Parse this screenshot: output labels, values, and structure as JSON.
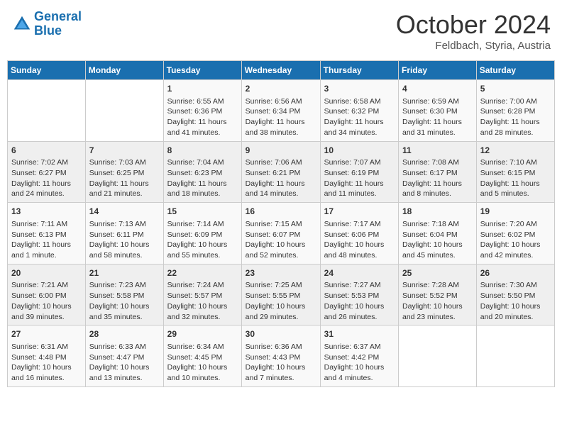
{
  "header": {
    "logo_line1": "General",
    "logo_line2": "Blue",
    "month": "October 2024",
    "location": "Feldbach, Styria, Austria"
  },
  "days_of_week": [
    "Sunday",
    "Monday",
    "Tuesday",
    "Wednesday",
    "Thursday",
    "Friday",
    "Saturday"
  ],
  "weeks": [
    [
      {
        "day": "",
        "info": ""
      },
      {
        "day": "",
        "info": ""
      },
      {
        "day": "1",
        "info": "Sunrise: 6:55 AM\nSunset: 6:36 PM\nDaylight: 11 hours and 41 minutes."
      },
      {
        "day": "2",
        "info": "Sunrise: 6:56 AM\nSunset: 6:34 PM\nDaylight: 11 hours and 38 minutes."
      },
      {
        "day": "3",
        "info": "Sunrise: 6:58 AM\nSunset: 6:32 PM\nDaylight: 11 hours and 34 minutes."
      },
      {
        "day": "4",
        "info": "Sunrise: 6:59 AM\nSunset: 6:30 PM\nDaylight: 11 hours and 31 minutes."
      },
      {
        "day": "5",
        "info": "Sunrise: 7:00 AM\nSunset: 6:28 PM\nDaylight: 11 hours and 28 minutes."
      }
    ],
    [
      {
        "day": "6",
        "info": "Sunrise: 7:02 AM\nSunset: 6:27 PM\nDaylight: 11 hours and 24 minutes."
      },
      {
        "day": "7",
        "info": "Sunrise: 7:03 AM\nSunset: 6:25 PM\nDaylight: 11 hours and 21 minutes."
      },
      {
        "day": "8",
        "info": "Sunrise: 7:04 AM\nSunset: 6:23 PM\nDaylight: 11 hours and 18 minutes."
      },
      {
        "day": "9",
        "info": "Sunrise: 7:06 AM\nSunset: 6:21 PM\nDaylight: 11 hours and 14 minutes."
      },
      {
        "day": "10",
        "info": "Sunrise: 7:07 AM\nSunset: 6:19 PM\nDaylight: 11 hours and 11 minutes."
      },
      {
        "day": "11",
        "info": "Sunrise: 7:08 AM\nSunset: 6:17 PM\nDaylight: 11 hours and 8 minutes."
      },
      {
        "day": "12",
        "info": "Sunrise: 7:10 AM\nSunset: 6:15 PM\nDaylight: 11 hours and 5 minutes."
      }
    ],
    [
      {
        "day": "13",
        "info": "Sunrise: 7:11 AM\nSunset: 6:13 PM\nDaylight: 11 hours and 1 minute."
      },
      {
        "day": "14",
        "info": "Sunrise: 7:13 AM\nSunset: 6:11 PM\nDaylight: 10 hours and 58 minutes."
      },
      {
        "day": "15",
        "info": "Sunrise: 7:14 AM\nSunset: 6:09 PM\nDaylight: 10 hours and 55 minutes."
      },
      {
        "day": "16",
        "info": "Sunrise: 7:15 AM\nSunset: 6:07 PM\nDaylight: 10 hours and 52 minutes."
      },
      {
        "day": "17",
        "info": "Sunrise: 7:17 AM\nSunset: 6:06 PM\nDaylight: 10 hours and 48 minutes."
      },
      {
        "day": "18",
        "info": "Sunrise: 7:18 AM\nSunset: 6:04 PM\nDaylight: 10 hours and 45 minutes."
      },
      {
        "day": "19",
        "info": "Sunrise: 7:20 AM\nSunset: 6:02 PM\nDaylight: 10 hours and 42 minutes."
      }
    ],
    [
      {
        "day": "20",
        "info": "Sunrise: 7:21 AM\nSunset: 6:00 PM\nDaylight: 10 hours and 39 minutes."
      },
      {
        "day": "21",
        "info": "Sunrise: 7:23 AM\nSunset: 5:58 PM\nDaylight: 10 hours and 35 minutes."
      },
      {
        "day": "22",
        "info": "Sunrise: 7:24 AM\nSunset: 5:57 PM\nDaylight: 10 hours and 32 minutes."
      },
      {
        "day": "23",
        "info": "Sunrise: 7:25 AM\nSunset: 5:55 PM\nDaylight: 10 hours and 29 minutes."
      },
      {
        "day": "24",
        "info": "Sunrise: 7:27 AM\nSunset: 5:53 PM\nDaylight: 10 hours and 26 minutes."
      },
      {
        "day": "25",
        "info": "Sunrise: 7:28 AM\nSunset: 5:52 PM\nDaylight: 10 hours and 23 minutes."
      },
      {
        "day": "26",
        "info": "Sunrise: 7:30 AM\nSunset: 5:50 PM\nDaylight: 10 hours and 20 minutes."
      }
    ],
    [
      {
        "day": "27",
        "info": "Sunrise: 6:31 AM\nSunset: 4:48 PM\nDaylight: 10 hours and 16 minutes."
      },
      {
        "day": "28",
        "info": "Sunrise: 6:33 AM\nSunset: 4:47 PM\nDaylight: 10 hours and 13 minutes."
      },
      {
        "day": "29",
        "info": "Sunrise: 6:34 AM\nSunset: 4:45 PM\nDaylight: 10 hours and 10 minutes."
      },
      {
        "day": "30",
        "info": "Sunrise: 6:36 AM\nSunset: 4:43 PM\nDaylight: 10 hours and 7 minutes."
      },
      {
        "day": "31",
        "info": "Sunrise: 6:37 AM\nSunset: 4:42 PM\nDaylight: 10 hours and 4 minutes."
      },
      {
        "day": "",
        "info": ""
      },
      {
        "day": "",
        "info": ""
      }
    ]
  ]
}
